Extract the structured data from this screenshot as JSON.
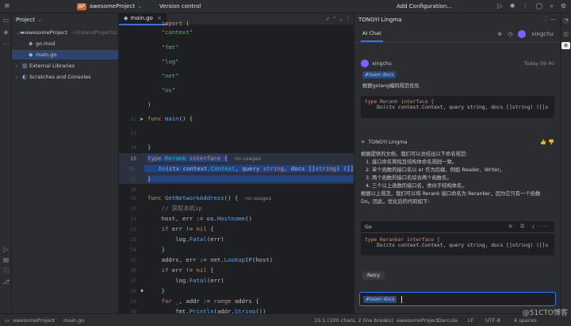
{
  "titlebar": {
    "project_badge": "AP",
    "project_name": "awesomeProject",
    "version_control": "Version control",
    "run_config": "Add Configuration..."
  },
  "project_panel": {
    "header": "Project",
    "items": [
      {
        "label": "awesomeProject",
        "path": "~/GolandProjects/..."
      },
      {
        "label": "go.mod"
      },
      {
        "label": "main.go"
      },
      {
        "label": "External Libraries"
      },
      {
        "label": "Scratches and Consoles"
      }
    ]
  },
  "editor": {
    "tab_label": "main.go",
    "lines": [
      {
        "num": "",
        "text": "\"context\""
      },
      {
        "num": "",
        "text": "\"fmt\""
      },
      {
        "num": "",
        "text": "\"log\""
      },
      {
        "num": "",
        "text": "\"net\""
      },
      {
        "num": "",
        "text": "\"os\""
      },
      {
        "num": "",
        "text": ")"
      },
      {
        "num": "12",
        "text": "func main() {"
      },
      {
        "num": "13",
        "text": ""
      },
      {
        "num": "14",
        "text": "}"
      },
      {
        "num": "15",
        "text": "type Rerank interface {"
      },
      {
        "num": "16",
        "text": "Do(ctx context.Context, query string, docs []string) ([]"
      },
      {
        "num": "17",
        "text": "}"
      },
      {
        "num": "18",
        "text": ""
      },
      {
        "num": "19",
        "text": "func GetNetworkAddress() {"
      },
      {
        "num": "20",
        "text": "// 获取本机ip"
      },
      {
        "num": "21",
        "text": "host, err := os.Hostname()"
      },
      {
        "num": "22",
        "text": "if err != nil {"
      },
      {
        "num": "23",
        "text": "log.Fatal(err)"
      },
      {
        "num": "24",
        "text": "}"
      },
      {
        "num": "25",
        "text": "addrs, err := net.LookupIP(host)"
      },
      {
        "num": "26",
        "text": "if err != nil {"
      },
      {
        "num": "27",
        "text": "log.Fatal(err)"
      },
      {
        "num": "28",
        "text": "}"
      },
      {
        "num": "29",
        "text": "for _, addr := range addrs {"
      },
      {
        "num": "30",
        "text": "fmt.Println(addr.String())"
      }
    ],
    "usage_hint": "no usages"
  },
  "chat": {
    "header": "TONGYI Lingma",
    "tab_label": "AI Chat",
    "user_name": "xingchu",
    "user": {
      "name": "xingchu",
      "time": "Today 09:40",
      "chip": "#team docs",
      "question": "根据golang编码规范优化"
    },
    "user_code": [
      "type Rerank interface {",
      "    Do(ctx context.Context, query string, docs []string) ([]s"
    ],
    "assistant": {
      "name": "TONGYI Lingma",
      "intro": "根据提供的文档，我们可以总结出以下命名规范:",
      "points": [
        "1. 接口命名简短且结构体命名规则一致。",
        "2. 单个函数的接口名以 er 作为后缀，例如 Reader、Writer。",
        "3. 两个函数的接口名综合两个函数名。",
        "4. 三个以上函数的接口名，类似于结构体名。"
      ],
      "conclusion": "根据以上规范，我们可以将 Rerank 接口命名为 Reranker，因为它只有一个函数",
      "conclusion2": "Do。因此，优化后的代码如下:",
      "code_lang": "Go",
      "code": [
        "type Reranker interface {",
        "    Do(ctx context.Context, query string, docs []string) ([]s"
      ],
      "retry": "Retry"
    },
    "input_chip": "#team docs"
  },
  "status": {
    "project": "awesomeProject",
    "file": "main.go",
    "position": "15:1 (100 chars, 2 line breaks)",
    "proj2": "awesomeProject",
    "theme": "Darcula",
    "lf": "LF",
    "encoding": "UTF-8",
    "indent": "4 spaces"
  },
  "watermark": "@51CTO博客"
}
